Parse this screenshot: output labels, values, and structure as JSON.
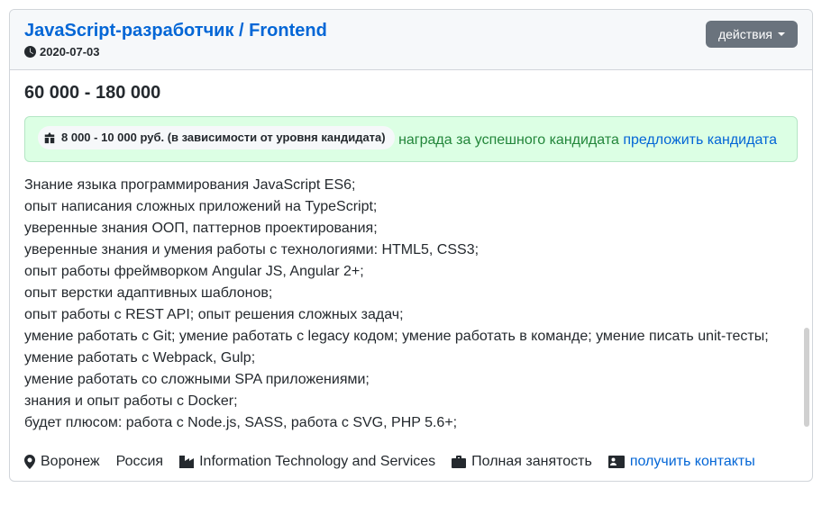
{
  "header": {
    "title": "JavaScript-разработчик / Frontend",
    "date": "2020-07-03",
    "actions_label": "действия"
  },
  "salary": "60 000 - 180 000",
  "reward": {
    "amount": "8 000 - 10 000 руб. (в зависимости от уровня кандидата)",
    "label": "награда за успешного кандидата",
    "suggest": "предложить кандидата"
  },
  "description": {
    "lines": [
      "Знание языка программирования JavaScript ES6;",
      "опыт написания сложных приложений на TypeScript;",
      "уверенные знания ООП, паттернов проектирования;",
      "уверенные знания и умения работы с технологиями: HTML5, CSS3;",
      "опыт работы фреймворком Angular JS, Angular 2+;",
      "опыт верстки адаптивных шаблонов;",
      "опыт работы с REST API; опыт решения сложных задач;",
      "умение работать с Git; умение работать с legacy кодом; умение работать в команде; умение писать unit-тесты;",
      "умение работать с Webpack, Gulp;",
      "умение работать со сложными SPA приложениями;",
      "знания и опыт работы с Docker;",
      "будет плюсом: работа с Node.js, SASS, работа с SVG, PHP 5.6+;"
    ]
  },
  "footer": {
    "location": "Воронеж",
    "country": "Россия",
    "industry": "Information Technology and Services",
    "employment": "Полная занятость",
    "contacts": "получить контакты"
  }
}
